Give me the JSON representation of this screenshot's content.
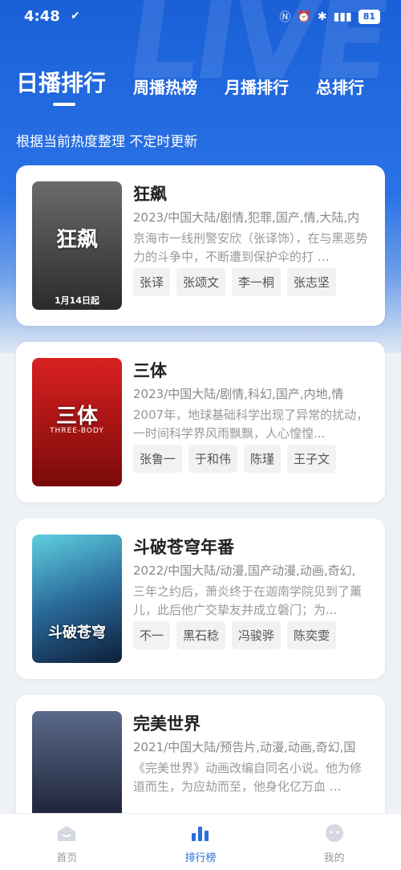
{
  "status": {
    "time": "4:48",
    "battery": "81"
  },
  "tabs": [
    {
      "label": "日播排行",
      "active": true
    },
    {
      "label": "周播热榜",
      "active": false
    },
    {
      "label": "月播排行",
      "active": false
    },
    {
      "label": "总排行",
      "active": false
    }
  ],
  "subtitle": "根据当前热度整理 不定时更新",
  "items": [
    {
      "title": "狂飙",
      "meta": "2023/中国大陆/剧情,犯罪,国产,情,大陆,内",
      "desc": "京海市一线刑警安欣（张译饰），在与黑恶势力的斗争中，不断遭到保护伞的打 …",
      "cast": [
        "张译",
        "张颂文",
        "李一桐",
        "张志坚"
      ],
      "poster": {
        "text": "狂飙",
        "sub": "",
        "date": "1月14日起",
        "colors": [
          "#5a5a5a",
          "#2b2b2b"
        ]
      }
    },
    {
      "title": "三体",
      "meta": "2023/中国大陆/剧情,科幻,国产,内地,情",
      "desc": "2007年，地球基础科学出现了异常的扰动，一时间科学界风雨飘飘，人心惶惶...",
      "cast": [
        "张鲁一",
        "于和伟",
        "陈瑾",
        "王子文"
      ],
      "poster": {
        "text": "三体",
        "sub": "THREE-BODY",
        "date": "",
        "colors": [
          "#d21f1f",
          "#6a0b0b"
        ]
      }
    },
    {
      "title": "斗破苍穹年番",
      "meta": "2022/中国大陆/动漫,国产动漫,动画,奇幻,",
      "desc": "三年之约后，萧炎终于在迦南学院见到了薰儿，此后他广交挚友并成立磐门；为...",
      "cast": [
        "不一",
        "黑石稔",
        "冯骏骅",
        "陈奕雯"
      ],
      "poster": {
        "text": "斗破苍穹",
        "sub": "",
        "date": "",
        "colors": [
          "#3ab0c9",
          "#102a4a"
        ]
      }
    },
    {
      "title": "完美世界",
      "meta": "2021/中国大陆/预告片,动漫,动画,奇幻,国",
      "desc": "《完美世界》动画改编自同名小说。他为修道而生，为应劫而至，他身化亿万血 …",
      "cast": [],
      "poster": {
        "text": "",
        "sub": "",
        "date": "",
        "colors": [
          "#4a5a7a",
          "#1a1f33"
        ]
      }
    }
  ],
  "nav": [
    {
      "label": "首页",
      "icon": "home-icon",
      "active": false
    },
    {
      "label": "排行榜",
      "icon": "chart-icon",
      "active": true
    },
    {
      "label": "我的",
      "icon": "profile-icon",
      "active": false
    }
  ],
  "colors": {
    "accent": "#2a6ee0",
    "hero": "#1a5fd6"
  }
}
